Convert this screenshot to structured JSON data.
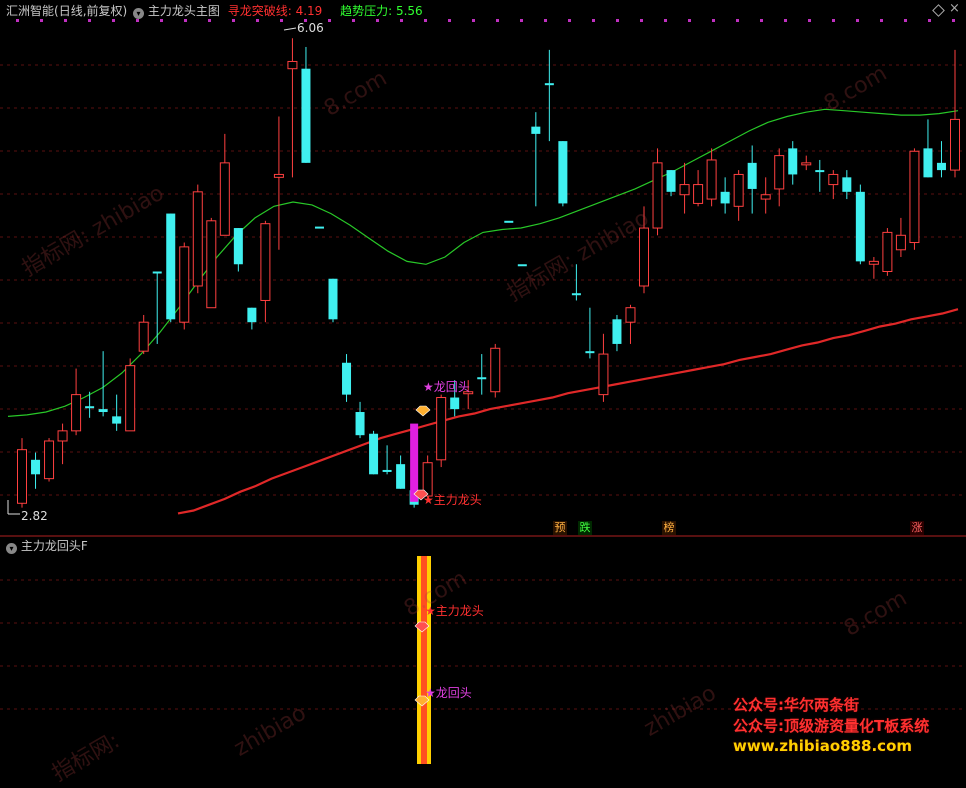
{
  "header": {
    "app_title": "汇洲智能",
    "mode": "(日线,前复权)",
    "indicator_name": "主力龙头主图",
    "line1_label": "寻龙突破线: ",
    "line1_value": "4.19",
    "line2_label": "趋势压力: ",
    "line2_value": "5.56",
    "colors": {
      "line1": "#ff3030",
      "line2": "#30ff30",
      "title": "#c8c8c8"
    }
  },
  "sub_header": {
    "title": "主力龙回头F"
  },
  "price_labels": {
    "high": "6.06",
    "low": "2.82"
  },
  "signals": {
    "dragon_head": "主力龙头",
    "dragon_return": "龙回头",
    "bottom_markers": [
      "预",
      "跌",
      "榜",
      "涨"
    ]
  },
  "watermarks": [
    "指标网: zhibiao",
    "8.com",
    "指标网: zhibiao",
    "8.com",
    "zhibiao",
    "8.com",
    "zhibiao",
    "8.com",
    "指标网:"
  ],
  "promo": {
    "line1": "公众号:华尔两条街",
    "line2": "公众号:顶级游资量化T板系统",
    "line3": "www.zhibiao888.com"
  },
  "icons": [
    "chevron-down-icon",
    "diamond-icon",
    "close-icon"
  ],
  "chart_data": {
    "type": "candlestick",
    "ylim": [
      2.7,
      6.2
    ],
    "candles": [
      {
        "o": 2.85,
        "h": 3.3,
        "l": 2.82,
        "c": 3.22,
        "up": true
      },
      {
        "o": 3.15,
        "h": 3.2,
        "l": 2.95,
        "c": 3.05,
        "up": false
      },
      {
        "o": 3.02,
        "h": 3.3,
        "l": 3.0,
        "c": 3.28,
        "up": true
      },
      {
        "o": 3.28,
        "h": 3.4,
        "l": 3.12,
        "c": 3.35,
        "up": true
      },
      {
        "o": 3.35,
        "h": 3.78,
        "l": 3.32,
        "c": 3.6,
        "up": true
      },
      {
        "o": 3.52,
        "h": 3.62,
        "l": 3.44,
        "c": 3.52,
        "up": false
      },
      {
        "o": 3.5,
        "h": 3.9,
        "l": 3.45,
        "c": 3.48,
        "up": false
      },
      {
        "o": 3.4,
        "h": 3.6,
        "l": 3.35,
        "c": 3.45,
        "up": false
      },
      {
        "o": 3.35,
        "h": 3.85,
        "l": 3.35,
        "c": 3.8,
        "up": true
      },
      {
        "o": 3.9,
        "h": 4.15,
        "l": 3.88,
        "c": 4.1,
        "up": true
      },
      {
        "o": 4.45,
        "h": 4.45,
        "l": 3.95,
        "c": 4.45,
        "up": false
      },
      {
        "o": 4.85,
        "h": 4.85,
        "l": 4.1,
        "c": 4.12,
        "up": false
      },
      {
        "o": 4.1,
        "h": 4.65,
        "l": 4.05,
        "c": 4.62,
        "up": true
      },
      {
        "o": 4.35,
        "h": 5.05,
        "l": 4.3,
        "c": 5.0,
        "up": true
      },
      {
        "o": 4.2,
        "h": 4.82,
        "l": 4.2,
        "c": 4.8,
        "up": true
      },
      {
        "o": 4.7,
        "h": 5.4,
        "l": 4.7,
        "c": 5.2,
        "up": true
      },
      {
        "o": 4.75,
        "h": 4.75,
        "l": 4.45,
        "c": 4.5,
        "up": false
      },
      {
        "o": 4.2,
        "h": 4.2,
        "l": 4.05,
        "c": 4.1,
        "up": false
      },
      {
        "o": 4.25,
        "h": 4.8,
        "l": 4.1,
        "c": 4.78,
        "up": true
      },
      {
        "o": 5.1,
        "h": 5.52,
        "l": 4.6,
        "c": 5.12,
        "up": true
      },
      {
        "o": 5.85,
        "h": 6.06,
        "l": 5.1,
        "c": 5.9,
        "up": true
      },
      {
        "o": 5.85,
        "h": 6.0,
        "l": 5.2,
        "c": 5.2,
        "up": false
      },
      {
        "o": 4.76,
        "h": 4.76,
        "l": 4.76,
        "c": 4.76,
        "up": false
      },
      {
        "o": 4.4,
        "h": 4.4,
        "l": 4.1,
        "c": 4.12,
        "up": false
      },
      {
        "o": 3.82,
        "h": 3.88,
        "l": 3.55,
        "c": 3.6,
        "up": false
      },
      {
        "o": 3.48,
        "h": 3.55,
        "l": 3.3,
        "c": 3.32,
        "up": false
      },
      {
        "o": 3.33,
        "h": 3.35,
        "l": 3.05,
        "c": 3.05,
        "up": false
      },
      {
        "o": 3.08,
        "h": 3.25,
        "l": 3.05,
        "c": 3.07,
        "up": false
      },
      {
        "o": 3.12,
        "h": 3.18,
        "l": 2.95,
        "c": 2.95,
        "up": false
      },
      {
        "o": 2.94,
        "h": 3.0,
        "l": 2.82,
        "c": 2.84,
        "up": false
      },
      {
        "o": 2.9,
        "h": 3.18,
        "l": 2.86,
        "c": 3.13,
        "up": true
      },
      {
        "o": 3.15,
        "h": 3.6,
        "l": 3.1,
        "c": 3.58,
        "up": true
      },
      {
        "o": 3.58,
        "h": 3.7,
        "l": 3.45,
        "c": 3.5,
        "up": false
      },
      {
        "o": 3.62,
        "h": 3.7,
        "l": 3.5,
        "c": 3.62,
        "up": true
      },
      {
        "o": 3.72,
        "h": 3.88,
        "l": 3.6,
        "c": 3.72,
        "up": false
      },
      {
        "o": 3.62,
        "h": 3.95,
        "l": 3.58,
        "c": 3.92,
        "up": true
      },
      {
        "o": 4.8,
        "h": 4.8,
        "l": 4.8,
        "c": 4.8,
        "up": false
      },
      {
        "o": 4.5,
        "h": 4.5,
        "l": 4.5,
        "c": 4.5,
        "up": false
      },
      {
        "o": 5.4,
        "h": 5.55,
        "l": 4.9,
        "c": 5.45,
        "up": false
      },
      {
        "o": 5.75,
        "h": 5.98,
        "l": 5.35,
        "c": 5.75,
        "up": false
      },
      {
        "o": 5.35,
        "h": 5.35,
        "l": 4.9,
        "c": 4.92,
        "up": false
      },
      {
        "o": 4.3,
        "h": 4.5,
        "l": 4.25,
        "c": 4.3,
        "up": false
      },
      {
        "o": 3.9,
        "h": 4.2,
        "l": 3.85,
        "c": 3.9,
        "up": false
      },
      {
        "o": 3.88,
        "h": 4.02,
        "l": 3.55,
        "c": 3.6,
        "up": true
      },
      {
        "o": 3.95,
        "h": 4.15,
        "l": 3.9,
        "c": 4.12,
        "up": false
      },
      {
        "o": 4.1,
        "h": 4.22,
        "l": 3.95,
        "c": 4.2,
        "up": true
      },
      {
        "o": 4.35,
        "h": 4.9,
        "l": 4.3,
        "c": 4.75,
        "up": true
      },
      {
        "o": 4.75,
        "h": 5.3,
        "l": 4.7,
        "c": 5.2,
        "up": true
      },
      {
        "o": 5.15,
        "h": 5.15,
        "l": 4.97,
        "c": 5.0,
        "up": false
      },
      {
        "o": 4.98,
        "h": 5.2,
        "l": 4.85,
        "c": 5.05,
        "up": true
      },
      {
        "o": 5.05,
        "h": 5.15,
        "l": 4.9,
        "c": 4.92,
        "up": true
      },
      {
        "o": 4.95,
        "h": 5.3,
        "l": 4.9,
        "c": 5.22,
        "up": true
      },
      {
        "o": 5.0,
        "h": 5.1,
        "l": 4.85,
        "c": 4.92,
        "up": false
      },
      {
        "o": 4.9,
        "h": 5.15,
        "l": 4.8,
        "c": 5.12,
        "up": true
      },
      {
        "o": 5.2,
        "h": 5.32,
        "l": 4.85,
        "c": 5.02,
        "up": false
      },
      {
        "o": 4.95,
        "h": 5.1,
        "l": 4.85,
        "c": 4.98,
        "up": true
      },
      {
        "o": 5.02,
        "h": 5.3,
        "l": 4.9,
        "c": 5.25,
        "up": true
      },
      {
        "o": 5.3,
        "h": 5.35,
        "l": 5.05,
        "c": 5.12,
        "up": false
      },
      {
        "o": 5.2,
        "h": 5.25,
        "l": 5.15,
        "c": 5.2,
        "up": true
      },
      {
        "o": 5.15,
        "h": 5.22,
        "l": 5.0,
        "c": 5.15,
        "up": false
      },
      {
        "o": 5.05,
        "h": 5.15,
        "l": 4.95,
        "c": 5.12,
        "up": true
      },
      {
        "o": 5.1,
        "h": 5.15,
        "l": 4.95,
        "c": 5.0,
        "up": false
      },
      {
        "o": 5.0,
        "h": 5.05,
        "l": 4.5,
        "c": 4.52,
        "up": false
      },
      {
        "o": 4.5,
        "h": 4.55,
        "l": 4.4,
        "c": 4.52,
        "up": true
      },
      {
        "o": 4.45,
        "h": 4.75,
        "l": 4.42,
        "c": 4.72,
        "up": true
      },
      {
        "o": 4.6,
        "h": 4.82,
        "l": 4.55,
        "c": 4.7,
        "up": true
      },
      {
        "o": 4.65,
        "h": 5.3,
        "l": 4.6,
        "c": 5.28,
        "up": true
      },
      {
        "o": 5.3,
        "h": 5.5,
        "l": 5.1,
        "c": 5.1,
        "up": false
      },
      {
        "o": 5.2,
        "h": 5.35,
        "l": 5.1,
        "c": 5.15,
        "up": false
      },
      {
        "o": 5.15,
        "h": 5.98,
        "l": 5.1,
        "c": 5.5,
        "up": true
      }
    ],
    "series": [
      {
        "name": "寻龙突破线",
        "color": "#e02828",
        "values": [
          2.78,
          2.8,
          2.84,
          2.88,
          2.93,
          2.97,
          3.02,
          3.06,
          3.1,
          3.14,
          3.18,
          3.22,
          3.26,
          3.3,
          3.33,
          3.36,
          3.39,
          3.42,
          3.45,
          3.47,
          3.5,
          3.52,
          3.54,
          3.56,
          3.58,
          3.61,
          3.63,
          3.65,
          3.67,
          3.69,
          3.71,
          3.73,
          3.75,
          3.77,
          3.79,
          3.81,
          3.84,
          3.86,
          3.88,
          3.91,
          3.94,
          3.96,
          3.99,
          4.01,
          4.04,
          4.07,
          4.09,
          4.12,
          4.14,
          4.16,
          4.19
        ]
      },
      {
        "name": "趋势压力",
        "color": "#28c828",
        "values": [
          3.45,
          3.46,
          3.48,
          3.52,
          3.58,
          3.65,
          3.75,
          3.88,
          4.03,
          4.2,
          4.38,
          4.55,
          4.7,
          4.82,
          4.9,
          4.93,
          4.91,
          4.85,
          4.77,
          4.68,
          4.59,
          4.52,
          4.5,
          4.55,
          4.65,
          4.72,
          4.74,
          4.75,
          4.78,
          4.82,
          4.87,
          4.92,
          4.97,
          5.02,
          5.08,
          5.14,
          5.21,
          5.28,
          5.35,
          5.42,
          5.48,
          5.52,
          5.55,
          5.57,
          5.56,
          5.55,
          5.54,
          5.53,
          5.53,
          5.54,
          5.56
        ]
      }
    ]
  }
}
